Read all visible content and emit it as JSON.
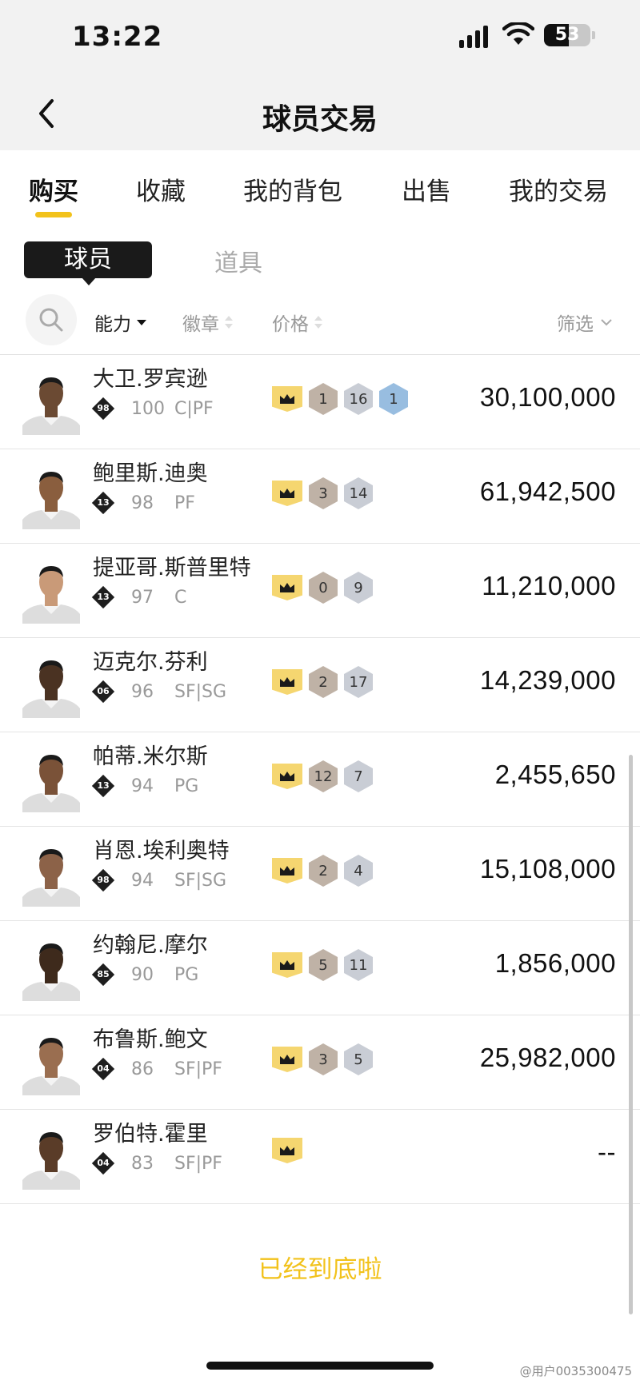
{
  "status_bar": {
    "time": "13:22",
    "battery": "53",
    "battery_level": 0.53
  },
  "header": {
    "title": "球员交易"
  },
  "main_tabs": [
    "购买",
    "收藏",
    "我的背包",
    "出售",
    "我的交易"
  ],
  "sub_tabs": {
    "active": "球员",
    "other": "道具"
  },
  "sort_bar": {
    "ability": "能力",
    "badge": "徽章",
    "price": "价格",
    "filter": "筛选"
  },
  "players": [
    {
      "name": "大卫.罗宾逊",
      "tier": "98",
      "rating": "100",
      "position": "C|PF",
      "badges": [
        {
          "type": "bronze",
          "count": "1"
        },
        {
          "type": "silver",
          "count": "16"
        },
        {
          "type": "gold",
          "count": "1"
        }
      ],
      "price": "30,100,000"
    },
    {
      "name": "鲍里斯.迪奥",
      "tier": "13",
      "rating": "98",
      "position": "PF",
      "badges": [
        {
          "type": "bronze",
          "count": "3"
        },
        {
          "type": "silver",
          "count": "14"
        }
      ],
      "price": "61,942,500"
    },
    {
      "name": "提亚哥.斯普里特",
      "tier": "13",
      "rating": "97",
      "position": "C",
      "badges": [
        {
          "type": "bronze",
          "count": "0"
        },
        {
          "type": "silver",
          "count": "9"
        }
      ],
      "price": "11,210,000"
    },
    {
      "name": "迈克尔.芬利",
      "tier": "06",
      "rating": "96",
      "position": "SF|SG",
      "badges": [
        {
          "type": "bronze",
          "count": "2"
        },
        {
          "type": "silver",
          "count": "17"
        }
      ],
      "price": "14,239,000"
    },
    {
      "name": "帕蒂.米尔斯",
      "tier": "13",
      "rating": "94",
      "position": "PG",
      "badges": [
        {
          "type": "bronze",
          "count": "12"
        },
        {
          "type": "silver",
          "count": "7"
        }
      ],
      "price": "2,455,650"
    },
    {
      "name": "肖恩.埃利奥特",
      "tier": "98",
      "rating": "94",
      "position": "SF|SG",
      "badges": [
        {
          "type": "bronze",
          "count": "2"
        },
        {
          "type": "silver",
          "count": "4"
        }
      ],
      "price": "15,108,000"
    },
    {
      "name": "约翰尼.摩尔",
      "tier": "85",
      "rating": "90",
      "position": "PG",
      "badges": [
        {
          "type": "bronze",
          "count": "5"
        },
        {
          "type": "silver",
          "count": "11"
        }
      ],
      "price": "1,856,000"
    },
    {
      "name": "布鲁斯.鲍文",
      "tier": "04",
      "rating": "86",
      "position": "SF|PF",
      "badges": [
        {
          "type": "bronze",
          "count": "3"
        },
        {
          "type": "silver",
          "count": "5"
        }
      ],
      "price": "25,982,000"
    },
    {
      "name": "罗伯特.霍里",
      "tier": "04",
      "rating": "83",
      "position": "SF|PF",
      "badges": [],
      "price": "--"
    }
  ],
  "end_text": "已经到底啦",
  "watermark": "@用户0035300475",
  "colors": {
    "accent": "#f2c21b",
    "crown": "#f5d670",
    "bronze": "#bfb2a6",
    "silver": "#c9cdd5",
    "gold": "#98bde0"
  },
  "icons": {
    "back": "chevron-left-icon",
    "search": "search-icon",
    "filter": "chevron-down-icon",
    "crown": "crown-icon"
  }
}
